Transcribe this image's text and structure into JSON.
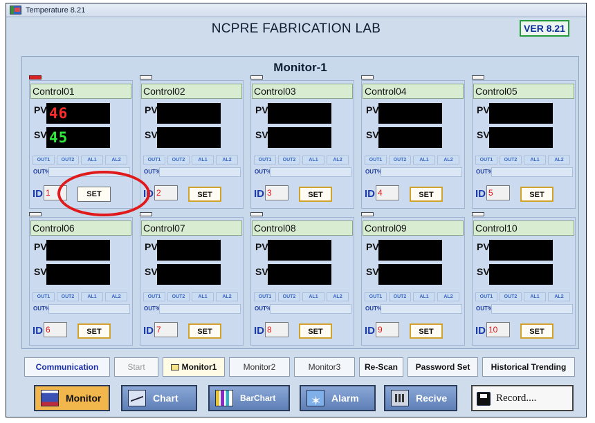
{
  "window": {
    "title": "Temperature 8.21",
    "app_icon": "app-icon"
  },
  "header": {
    "lab_title": "NCPRE FABRICATION LAB",
    "version": "VER 8.21"
  },
  "monitor": {
    "title": "Monitor-1"
  },
  "controllers": [
    {
      "name": "Control01",
      "pv": "46",
      "sv": "45",
      "id": "1",
      "led": "on"
    },
    {
      "name": "Control02",
      "pv": "",
      "sv": "",
      "id": "2",
      "led": "off"
    },
    {
      "name": "Control03",
      "pv": "",
      "sv": "",
      "id": "3",
      "led": "off"
    },
    {
      "name": "Control04",
      "pv": "",
      "sv": "",
      "id": "4",
      "led": "off"
    },
    {
      "name": "Control05",
      "pv": "",
      "sv": "",
      "id": "5",
      "led": "off"
    },
    {
      "name": "Control06",
      "pv": "",
      "sv": "",
      "id": "6",
      "led": "off"
    },
    {
      "name": "Control07",
      "pv": "",
      "sv": "",
      "id": "7",
      "led": "off"
    },
    {
      "name": "Control08",
      "pv": "",
      "sv": "",
      "id": "8",
      "led": "off"
    },
    {
      "name": "Control09",
      "pv": "",
      "sv": "",
      "id": "9",
      "led": "off"
    },
    {
      "name": "Control10",
      "pv": "",
      "sv": "",
      "id": "10",
      "led": "off"
    }
  ],
  "panel_labels": {
    "pv": "PV",
    "sv": "SV",
    "out1": "OUT1",
    "out2": "OUT2",
    "al1": "AL1",
    "al2": "AL2",
    "out_percent": "OUT%",
    "id": "ID",
    "set": "SET"
  },
  "toolbar": {
    "communication": "Communication",
    "start": "Start",
    "monitor1": "Monitor1",
    "monitor2": "Monitor2",
    "monitor3": "Monitor3",
    "rescan": "Re-Scan",
    "password_set": "Password Set",
    "historical_trending": "Historical Trending"
  },
  "nav": {
    "monitor": "Monitor",
    "chart": "Chart",
    "barchart": "BarChart",
    "alarm": "Alarm",
    "recive": "Recive",
    "record": "Record...."
  },
  "colors": {
    "pv_digits": "#ff2b2b",
    "sv_digits": "#2eea3a",
    "annotation": "#e01a1a",
    "monitor_button": "#f1b64c"
  }
}
